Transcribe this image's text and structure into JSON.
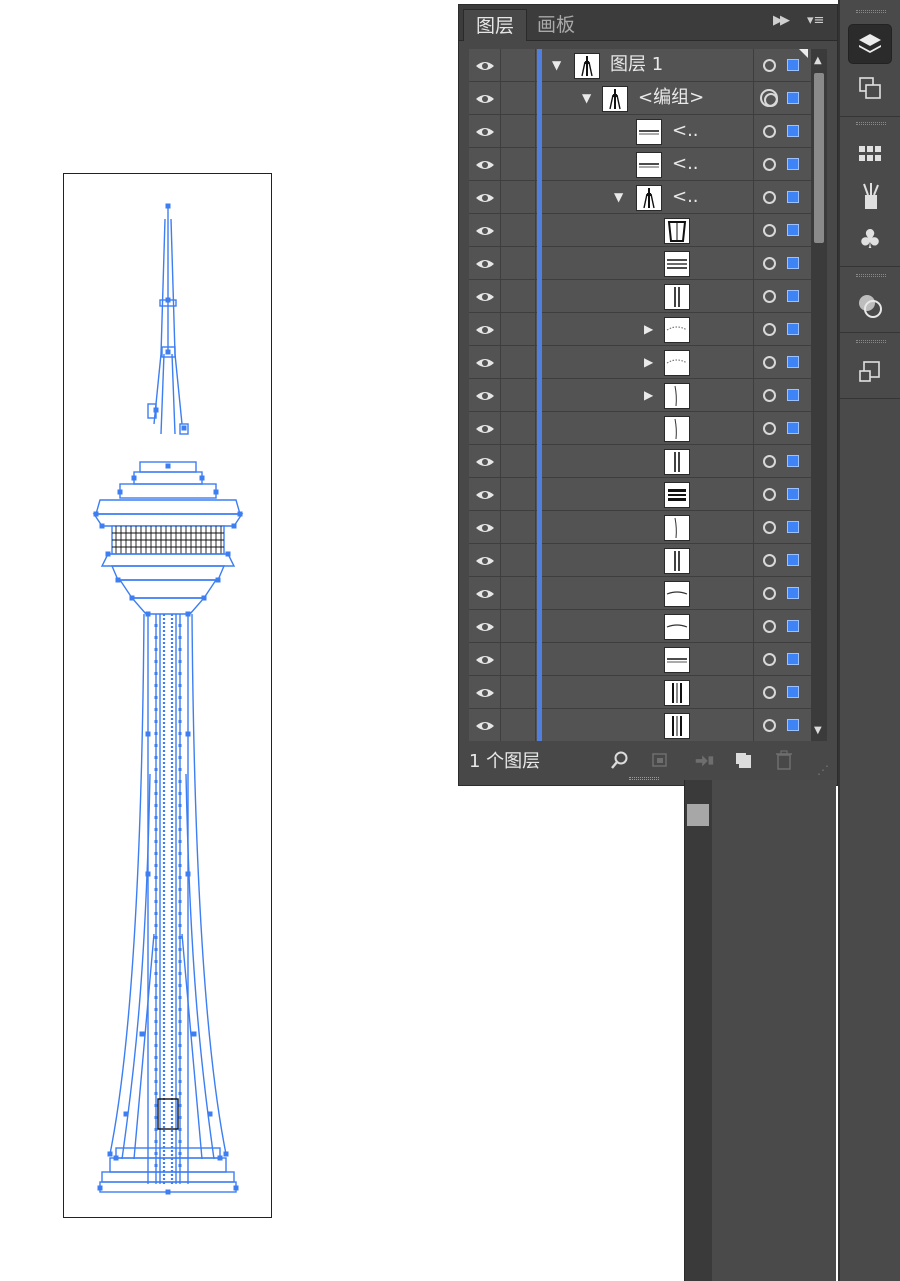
{
  "panel": {
    "tabs": [
      {
        "label": "图层",
        "active": true
      },
      {
        "label": "画板",
        "active": false
      }
    ],
    "layer_count_label": "1 个图层"
  },
  "rows": [
    {
      "label": "图层 1",
      "depth": 0,
      "expanded": true,
      "thumb": "tower",
      "target": "single"
    },
    {
      "label": "<编组>",
      "depth": 1,
      "expanded": true,
      "thumb": "tower",
      "target": "double"
    },
    {
      "label": "<..",
      "depth": 2,
      "expanded": null,
      "thumb": "bar",
      "target": "single"
    },
    {
      "label": "<..",
      "depth": 2,
      "expanded": null,
      "thumb": "bar",
      "target": "single"
    },
    {
      "label": "<..",
      "depth": 2,
      "expanded": true,
      "thumb": "tower",
      "target": "single"
    },
    {
      "label": "",
      "depth": 3,
      "expanded": null,
      "thumb": "frame",
      "target": "single"
    },
    {
      "label": "",
      "depth": 3,
      "expanded": null,
      "thumb": "lines",
      "target": "single"
    },
    {
      "label": "",
      "depth": 3,
      "expanded": null,
      "thumb": "split",
      "target": "single"
    },
    {
      "label": "",
      "depth": 3,
      "expanded": false,
      "thumb": "arc",
      "target": "single"
    },
    {
      "label": "",
      "depth": 3,
      "expanded": false,
      "thumb": "arc",
      "target": "single"
    },
    {
      "label": "",
      "depth": 3,
      "expanded": false,
      "thumb": "curve",
      "target": "single"
    },
    {
      "label": "",
      "depth": 3,
      "expanded": null,
      "thumb": "curve",
      "target": "single"
    },
    {
      "label": "",
      "depth": 3,
      "expanded": null,
      "thumb": "split",
      "target": "single"
    },
    {
      "label": "",
      "depth": 3,
      "expanded": null,
      "thumb": "stack",
      "target": "single"
    },
    {
      "label": "",
      "depth": 3,
      "expanded": null,
      "thumb": "curve",
      "target": "single"
    },
    {
      "label": "",
      "depth": 3,
      "expanded": null,
      "thumb": "split",
      "target": "single"
    },
    {
      "label": "",
      "depth": 3,
      "expanded": null,
      "thumb": "hump",
      "target": "single"
    },
    {
      "label": "",
      "depth": 3,
      "expanded": null,
      "thumb": "hump",
      "target": "single"
    },
    {
      "label": "",
      "depth": 3,
      "expanded": null,
      "thumb": "bar",
      "target": "single"
    },
    {
      "label": "",
      "depth": 3,
      "expanded": null,
      "thumb": "pillars",
      "target": "single"
    },
    {
      "label": "",
      "depth": 3,
      "expanded": null,
      "thumb": "pillars",
      "target": "single"
    }
  ],
  "colors": {
    "layer_color": "#4f7fe0",
    "selection_blue": "#3f84f7",
    "outline_blue": "#3d7ef2",
    "panel_bg": "#484848",
    "row_bg": "#535353"
  },
  "icons": {
    "footer": [
      "search-icon",
      "clipping-mask-icon",
      "move-to-layer-icon",
      "new-layer-icon",
      "delete-icon"
    ],
    "tools": [
      "layers-icon",
      "artboards-icon",
      "swatches-icon",
      "brushes-icon",
      "symbols-icon",
      "appearance-icon",
      "transform-icon"
    ]
  }
}
